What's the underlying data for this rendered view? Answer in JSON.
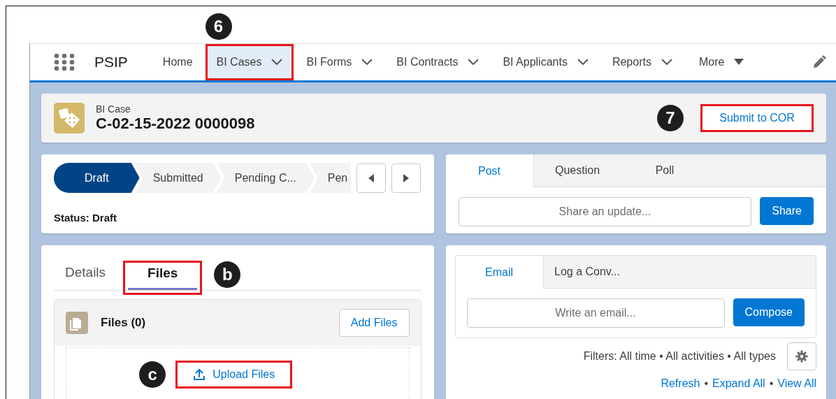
{
  "nav": {
    "app_name": "PSIP",
    "items": [
      {
        "label": "Home",
        "dropdown": false,
        "selected": false,
        "highlighted": false
      },
      {
        "label": "BI Cases",
        "dropdown": true,
        "selected": true,
        "highlighted": true,
        "callout": "6"
      },
      {
        "label": "BI Forms",
        "dropdown": true,
        "selected": false,
        "highlighted": false
      },
      {
        "label": "BI Contracts",
        "dropdown": true,
        "selected": false,
        "highlighted": false
      },
      {
        "label": "BI Applicants",
        "dropdown": true,
        "selected": false,
        "highlighted": false
      },
      {
        "label": "Reports",
        "dropdown": true,
        "selected": false,
        "highlighted": false
      }
    ],
    "more": "More"
  },
  "record_header": {
    "object": "BI Case",
    "title": "C-02-15-2022 0000098",
    "action": {
      "label": "Submit to COR",
      "highlighted": true,
      "callout": "7"
    }
  },
  "path": {
    "stages": [
      {
        "label": "Draft",
        "selected": true
      },
      {
        "label": "Submitted",
        "selected": false
      },
      {
        "label": "Pending C...",
        "selected": false
      },
      {
        "label": "Pen",
        "selected": false
      }
    ],
    "status": "Status: Draft"
  },
  "publisher": {
    "tabs": [
      {
        "label": "Post",
        "selected": true
      },
      {
        "label": "Question",
        "selected": false
      },
      {
        "label": "Poll",
        "selected": false
      }
    ],
    "placeholder": "Share an update...",
    "button": "Share"
  },
  "related": {
    "tabs": [
      {
        "label": "Details",
        "selected": false,
        "highlighted": false
      },
      {
        "label": "Files",
        "selected": true,
        "highlighted": true,
        "callout": "b"
      }
    ],
    "files": {
      "title": "Files (0)",
      "add_button": "Add Files",
      "upload": {
        "label": "Upload Files",
        "highlighted": true,
        "callout": "c"
      }
    }
  },
  "activity": {
    "tabs": [
      {
        "label": "Email",
        "selected": true
      },
      {
        "label": "Log a Conv...",
        "selected": false
      }
    ],
    "placeholder": "Write an email...",
    "button": "Compose",
    "filters": "Filters: All time • All activities • All types",
    "links": [
      "Refresh",
      "Expand All",
      "View All"
    ],
    "separator": "•"
  }
}
